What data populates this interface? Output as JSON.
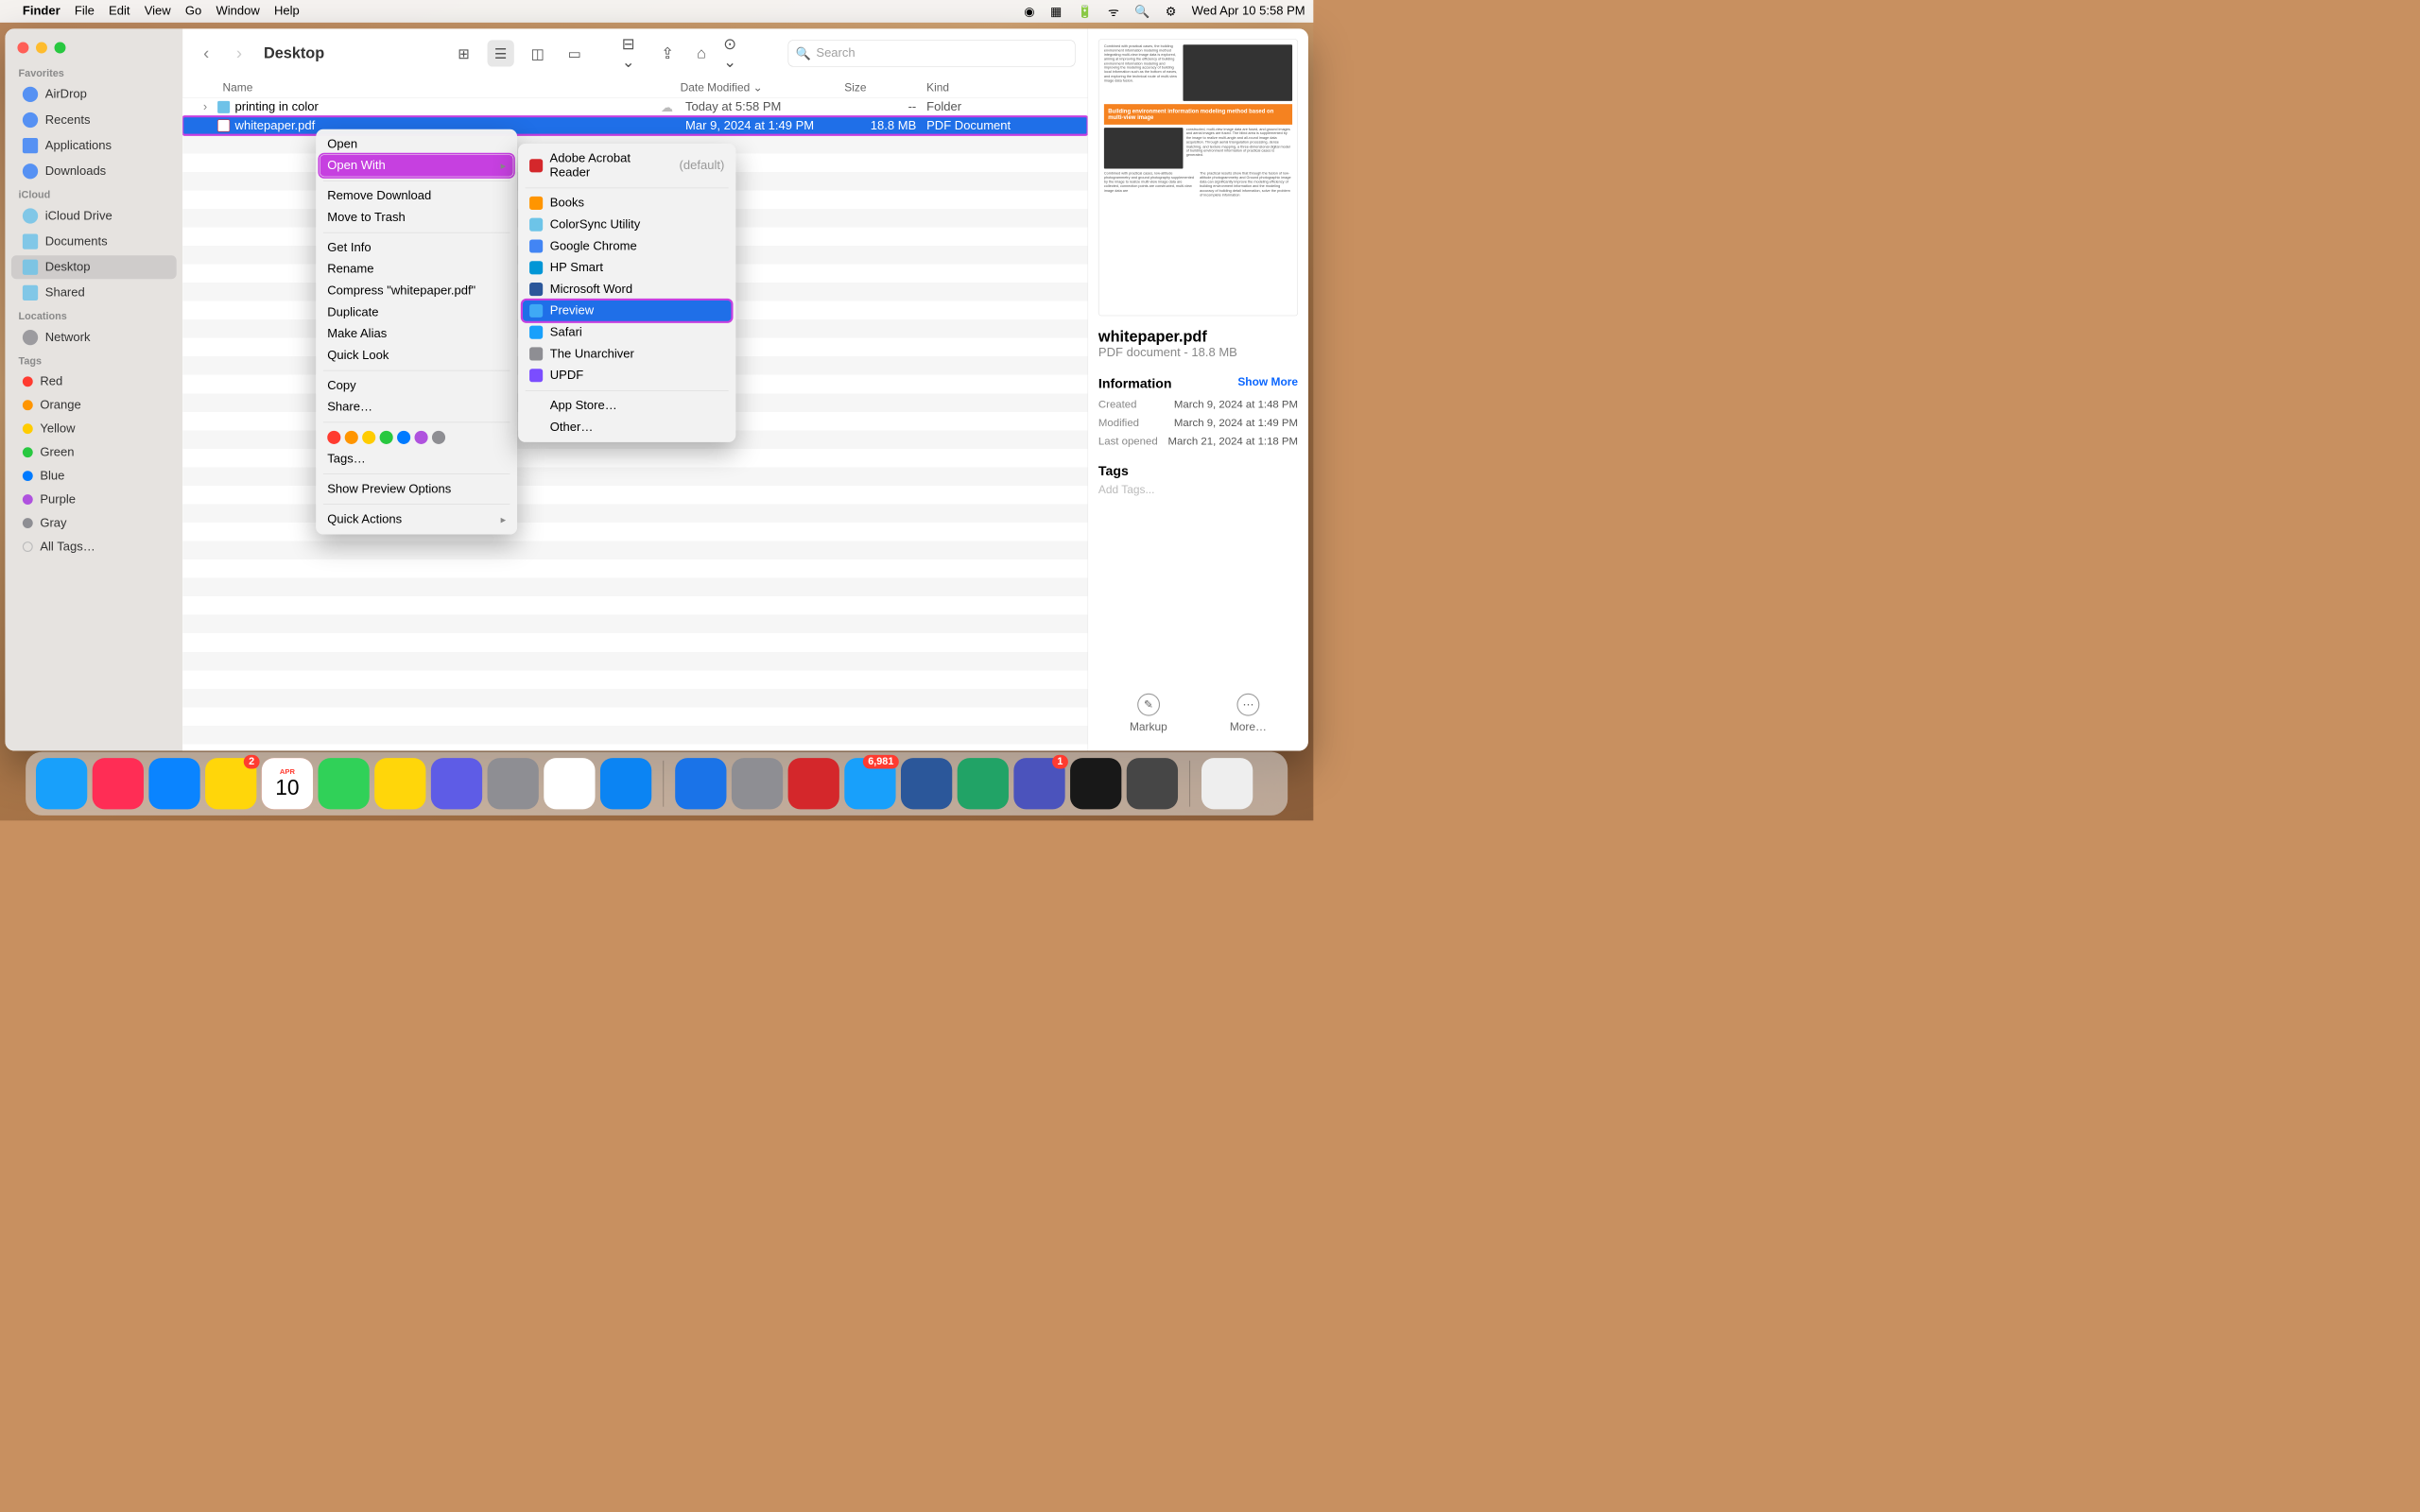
{
  "menubar": {
    "app": "Finder",
    "items": [
      "File",
      "Edit",
      "View",
      "Go",
      "Window",
      "Help"
    ],
    "clock": "Wed Apr 10  5:58 PM"
  },
  "window": {
    "title": "Desktop"
  },
  "search": {
    "placeholder": "Search"
  },
  "sidebar": {
    "sections": [
      {
        "title": "Favorites",
        "items": [
          "AirDrop",
          "Recents",
          "Applications",
          "Downloads"
        ]
      },
      {
        "title": "iCloud",
        "items": [
          "iCloud Drive",
          "Documents",
          "Desktop",
          "Shared"
        ]
      },
      {
        "title": "Locations",
        "items": [
          "Network"
        ]
      },
      {
        "title": "Tags",
        "tags": [
          {
            "label": "Red",
            "c": "#ff3b30"
          },
          {
            "label": "Orange",
            "c": "#ff9500"
          },
          {
            "label": "Yellow",
            "c": "#ffcc00"
          },
          {
            "label": "Green",
            "c": "#28c840"
          },
          {
            "label": "Blue",
            "c": "#007aff"
          },
          {
            "label": "Purple",
            "c": "#af52de"
          },
          {
            "label": "Gray",
            "c": "#8e8e93"
          },
          {
            "label": "All Tags…",
            "c": null
          }
        ]
      }
    ],
    "active": "Desktop"
  },
  "columns": {
    "name": "Name",
    "date": "Date Modified",
    "size": "Size",
    "kind": "Kind"
  },
  "rows": [
    {
      "name": "printing in color",
      "date": "Today at 5:58 PM",
      "size": "--",
      "kind": "Folder",
      "folder": true
    },
    {
      "name": "whitepaper.pdf",
      "date": "Mar 9, 2024 at 1:49 PM",
      "size": "18.8 MB",
      "kind": "PDF Document",
      "selected": true
    }
  ],
  "ctx": [
    "Open",
    {
      "label": "Open With",
      "hl": true,
      "sub": true
    },
    "---",
    "Remove Download",
    "Move to Trash",
    "---",
    "Get Info",
    "Rename",
    "Compress \"whitepaper.pdf\"",
    "Duplicate",
    "Make Alias",
    "Quick Look",
    "---",
    "Copy",
    "Share…",
    "---",
    "__TAGS__",
    "Tags…",
    "---",
    "Show Preview Options",
    "---",
    {
      "label": "Quick Actions",
      "sub": true
    }
  ],
  "ctx_tag_colors": [
    "#ff3b30",
    "#ff9500",
    "#ffcc00",
    "#28c840",
    "#007aff",
    "#af52de",
    "#8e8e93"
  ],
  "ctx2": [
    {
      "label": "Adobe Acrobat Reader",
      "default": "(default)",
      "c": "#d4272b"
    },
    "---",
    {
      "label": "Books",
      "c": "#ff9500"
    },
    {
      "label": "ColorSync Utility",
      "c": "#6dc4e8"
    },
    {
      "label": "Google Chrome",
      "c": "#4285f4"
    },
    {
      "label": "HP Smart",
      "c": "#0096d6"
    },
    {
      "label": "Microsoft Word",
      "c": "#2b579a"
    },
    {
      "label": "Preview",
      "c": "#3fa9f5",
      "sel": true
    },
    {
      "label": "Safari",
      "c": "#18a0fb"
    },
    {
      "label": "The Unarchiver",
      "c": "#8e8e93"
    },
    {
      "label": "UPDF",
      "c": "#7b4dff"
    },
    "---",
    {
      "label": "App Store…"
    },
    {
      "label": "Other…"
    }
  ],
  "preview": {
    "name": "whitepaper.pdf",
    "subtitle": "PDF document - 18.8 MB",
    "info_title": "Information",
    "show_more": "Show More",
    "thumb_title": "Building environment information modeling method based on multi-view image",
    "rows": [
      {
        "k": "Created",
        "v": "March 9, 2024 at 1:48 PM"
      },
      {
        "k": "Modified",
        "v": "March 9, 2024 at 1:49 PM"
      },
      {
        "k": "Last opened",
        "v": "March 21, 2024 at 1:18 PM"
      }
    ],
    "tags_title": "Tags",
    "add_tags": "Add Tags...",
    "actions": [
      "Markup",
      "More…"
    ]
  },
  "dock": {
    "apps": [
      {
        "c": "#18a0fb"
      },
      {
        "c": "#ff2d55"
      },
      {
        "c": "#0a84ff"
      },
      {
        "c": "#ffd60a",
        "badge": "2"
      },
      {
        "c": "#ff3b30",
        "label": "10",
        "sub": "APR"
      },
      {
        "c": "#30d158"
      },
      {
        "c": "#ffd60a"
      },
      {
        "c": "#5e5ce6"
      },
      {
        "c": "#8e8e93"
      },
      {
        "c": "#ffffff"
      },
      {
        "c": "#0b84f3"
      },
      {
        "sep": true
      },
      {
        "c": "#1a73e8"
      },
      {
        "c": "#8e8e93"
      },
      {
        "c": "#d4272b"
      },
      {
        "c": "#18a0fb",
        "badge": "6,981"
      },
      {
        "c": "#2b579a"
      },
      {
        "c": "#21a366"
      },
      {
        "c": "#4b53bc",
        "badge": "1"
      },
      {
        "c": "#181818"
      },
      {
        "c": "#464646"
      },
      {
        "sep": true
      },
      {
        "c": "#eeeeee"
      }
    ]
  }
}
